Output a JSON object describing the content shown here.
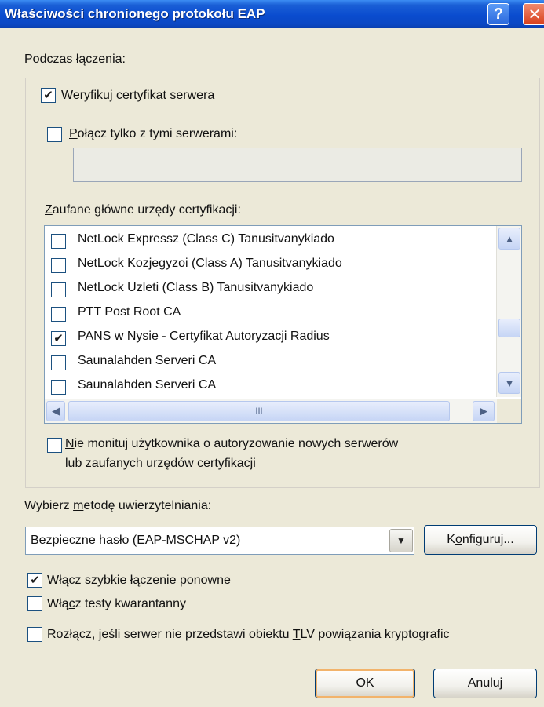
{
  "window": {
    "title": "Właściwości chronionego protokołu EAP",
    "help_glyph": "?",
    "close_glyph": "✕"
  },
  "connect_section": {
    "heading": "Podczas łączenia:",
    "verify_cert": {
      "underline_char": "W",
      "rest": "eryfikuj certyfikat serwera",
      "checked": true
    },
    "connect_only": {
      "underline_char": "P",
      "rest": "ołącz tylko z tymi serwerami:",
      "checked": false
    },
    "servers_input_value": "",
    "trusted_ca_label": {
      "underline_char": "Z",
      "rest": "aufane główne urzędy certyfikacji:"
    },
    "ca_list": [
      {
        "label": "NetLock Expressz (Class C) Tanusitvanykiado",
        "checked": false
      },
      {
        "label": "NetLock Kozjegyzoi (Class A) Tanusitvanykiado",
        "checked": false
      },
      {
        "label": "NetLock Uzleti (Class B) Tanusitvanykiado",
        "checked": false
      },
      {
        "label": "PTT Post Root CA",
        "checked": false
      },
      {
        "label": "PANS  w Nysie - Certyfikat Autoryzacji Radius",
        "checked": true
      },
      {
        "label": "Saunalahden Serveri CA",
        "checked": false
      },
      {
        "label": "Saunalahden Serveri CA",
        "checked": false
      }
    ],
    "do_not_prompt": {
      "underline_char": "N",
      "line1_rest": "ie monituj użytkownika o autoryzowanie nowych serwerów",
      "line2": "lub zaufanych urzędów certyfikacji",
      "checked": false
    }
  },
  "auth_method": {
    "label_before": "Wybierz ",
    "label_underline": "m",
    "label_after": "etodę uwierzytelniania:",
    "selected": "Bezpieczne hasło (EAP-MSCHAP v2)",
    "configure_before": "K",
    "configure_underline": "o",
    "configure_after": "nfiguruj..."
  },
  "options": {
    "fast_reconnect": {
      "before": "Włącz ",
      "underline": "s",
      "after": "zybkie łączenie ponowne",
      "checked": true
    },
    "quarantine": {
      "before": "Włą",
      "underline": "c",
      "after": "z testy kwarantanny",
      "checked": false
    },
    "disconnect": {
      "before": "Rozłącz, jeśli serwer nie przedstawi obiektu ",
      "underline": "T",
      "after": "LV powiązania kryptografic",
      "checked": false
    }
  },
  "buttons": {
    "ok": "OK",
    "cancel": "Anuluj"
  },
  "glyphs": {
    "check": "✔",
    "arrow_up": "▲",
    "arrow_down": "▼",
    "arrow_left": "◀",
    "arrow_right": "▶",
    "grip": "III"
  }
}
